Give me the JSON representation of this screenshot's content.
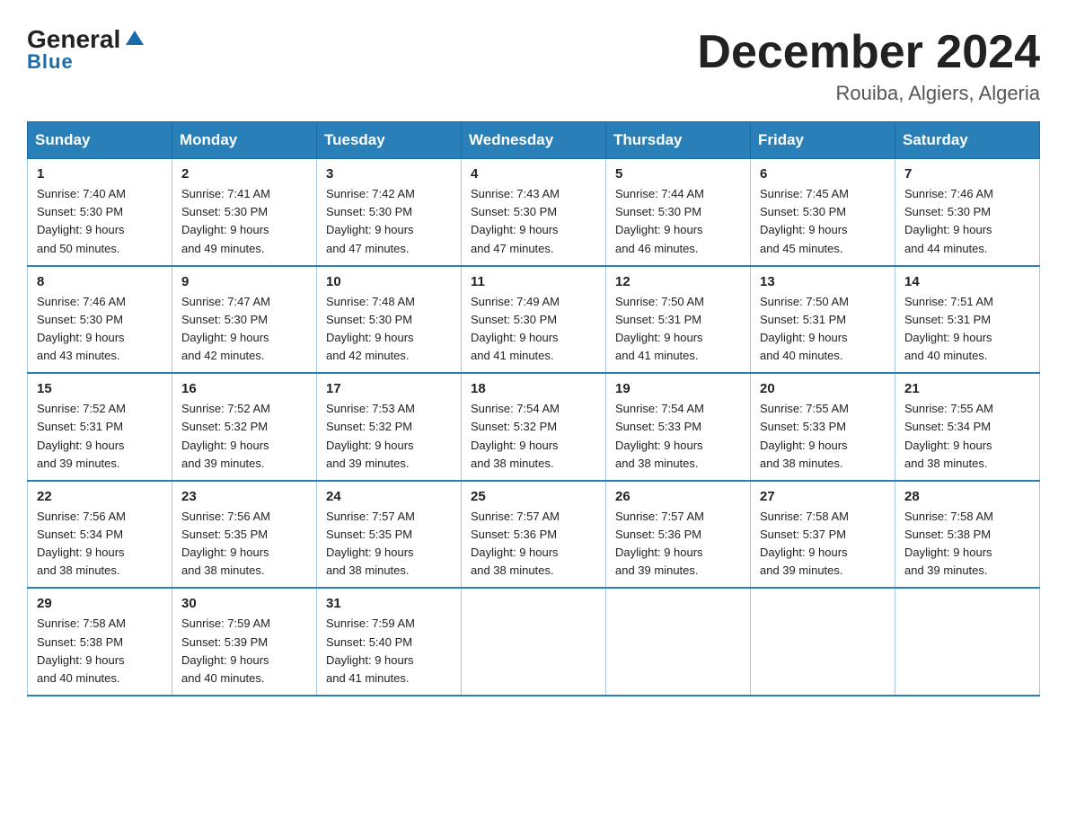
{
  "header": {
    "logo_general": "General",
    "logo_blue": "Blue",
    "month_title": "December 2024",
    "location": "Rouiba, Algiers, Algeria"
  },
  "calendar": {
    "days_of_week": [
      "Sunday",
      "Monday",
      "Tuesday",
      "Wednesday",
      "Thursday",
      "Friday",
      "Saturday"
    ],
    "weeks": [
      [
        {
          "day": "1",
          "sunrise": "7:40 AM",
          "sunset": "5:30 PM",
          "daylight": "9 hours and 50 minutes."
        },
        {
          "day": "2",
          "sunrise": "7:41 AM",
          "sunset": "5:30 PM",
          "daylight": "9 hours and 49 minutes."
        },
        {
          "day": "3",
          "sunrise": "7:42 AM",
          "sunset": "5:30 PM",
          "daylight": "9 hours and 47 minutes."
        },
        {
          "day": "4",
          "sunrise": "7:43 AM",
          "sunset": "5:30 PM",
          "daylight": "9 hours and 47 minutes."
        },
        {
          "day": "5",
          "sunrise": "7:44 AM",
          "sunset": "5:30 PM",
          "daylight": "9 hours and 46 minutes."
        },
        {
          "day": "6",
          "sunrise": "7:45 AM",
          "sunset": "5:30 PM",
          "daylight": "9 hours and 45 minutes."
        },
        {
          "day": "7",
          "sunrise": "7:46 AM",
          "sunset": "5:30 PM",
          "daylight": "9 hours and 44 minutes."
        }
      ],
      [
        {
          "day": "8",
          "sunrise": "7:46 AM",
          "sunset": "5:30 PM",
          "daylight": "9 hours and 43 minutes."
        },
        {
          "day": "9",
          "sunrise": "7:47 AM",
          "sunset": "5:30 PM",
          "daylight": "9 hours and 42 minutes."
        },
        {
          "day": "10",
          "sunrise": "7:48 AM",
          "sunset": "5:30 PM",
          "daylight": "9 hours and 42 minutes."
        },
        {
          "day": "11",
          "sunrise": "7:49 AM",
          "sunset": "5:30 PM",
          "daylight": "9 hours and 41 minutes."
        },
        {
          "day": "12",
          "sunrise": "7:50 AM",
          "sunset": "5:31 PM",
          "daylight": "9 hours and 41 minutes."
        },
        {
          "day": "13",
          "sunrise": "7:50 AM",
          "sunset": "5:31 PM",
          "daylight": "9 hours and 40 minutes."
        },
        {
          "day": "14",
          "sunrise": "7:51 AM",
          "sunset": "5:31 PM",
          "daylight": "9 hours and 40 minutes."
        }
      ],
      [
        {
          "day": "15",
          "sunrise": "7:52 AM",
          "sunset": "5:31 PM",
          "daylight": "9 hours and 39 minutes."
        },
        {
          "day": "16",
          "sunrise": "7:52 AM",
          "sunset": "5:32 PM",
          "daylight": "9 hours and 39 minutes."
        },
        {
          "day": "17",
          "sunrise": "7:53 AM",
          "sunset": "5:32 PM",
          "daylight": "9 hours and 39 minutes."
        },
        {
          "day": "18",
          "sunrise": "7:54 AM",
          "sunset": "5:32 PM",
          "daylight": "9 hours and 38 minutes."
        },
        {
          "day": "19",
          "sunrise": "7:54 AM",
          "sunset": "5:33 PM",
          "daylight": "9 hours and 38 minutes."
        },
        {
          "day": "20",
          "sunrise": "7:55 AM",
          "sunset": "5:33 PM",
          "daylight": "9 hours and 38 minutes."
        },
        {
          "day": "21",
          "sunrise": "7:55 AM",
          "sunset": "5:34 PM",
          "daylight": "9 hours and 38 minutes."
        }
      ],
      [
        {
          "day": "22",
          "sunrise": "7:56 AM",
          "sunset": "5:34 PM",
          "daylight": "9 hours and 38 minutes."
        },
        {
          "day": "23",
          "sunrise": "7:56 AM",
          "sunset": "5:35 PM",
          "daylight": "9 hours and 38 minutes."
        },
        {
          "day": "24",
          "sunrise": "7:57 AM",
          "sunset": "5:35 PM",
          "daylight": "9 hours and 38 minutes."
        },
        {
          "day": "25",
          "sunrise": "7:57 AM",
          "sunset": "5:36 PM",
          "daylight": "9 hours and 38 minutes."
        },
        {
          "day": "26",
          "sunrise": "7:57 AM",
          "sunset": "5:36 PM",
          "daylight": "9 hours and 39 minutes."
        },
        {
          "day": "27",
          "sunrise": "7:58 AM",
          "sunset": "5:37 PM",
          "daylight": "9 hours and 39 minutes."
        },
        {
          "day": "28",
          "sunrise": "7:58 AM",
          "sunset": "5:38 PM",
          "daylight": "9 hours and 39 minutes."
        }
      ],
      [
        {
          "day": "29",
          "sunrise": "7:58 AM",
          "sunset": "5:38 PM",
          "daylight": "9 hours and 40 minutes."
        },
        {
          "day": "30",
          "sunrise": "7:59 AM",
          "sunset": "5:39 PM",
          "daylight": "9 hours and 40 minutes."
        },
        {
          "day": "31",
          "sunrise": "7:59 AM",
          "sunset": "5:40 PM",
          "daylight": "9 hours and 41 minutes."
        },
        null,
        null,
        null,
        null
      ]
    ],
    "sunrise_label": "Sunrise:",
    "sunset_label": "Sunset:",
    "daylight_label": "Daylight:"
  }
}
